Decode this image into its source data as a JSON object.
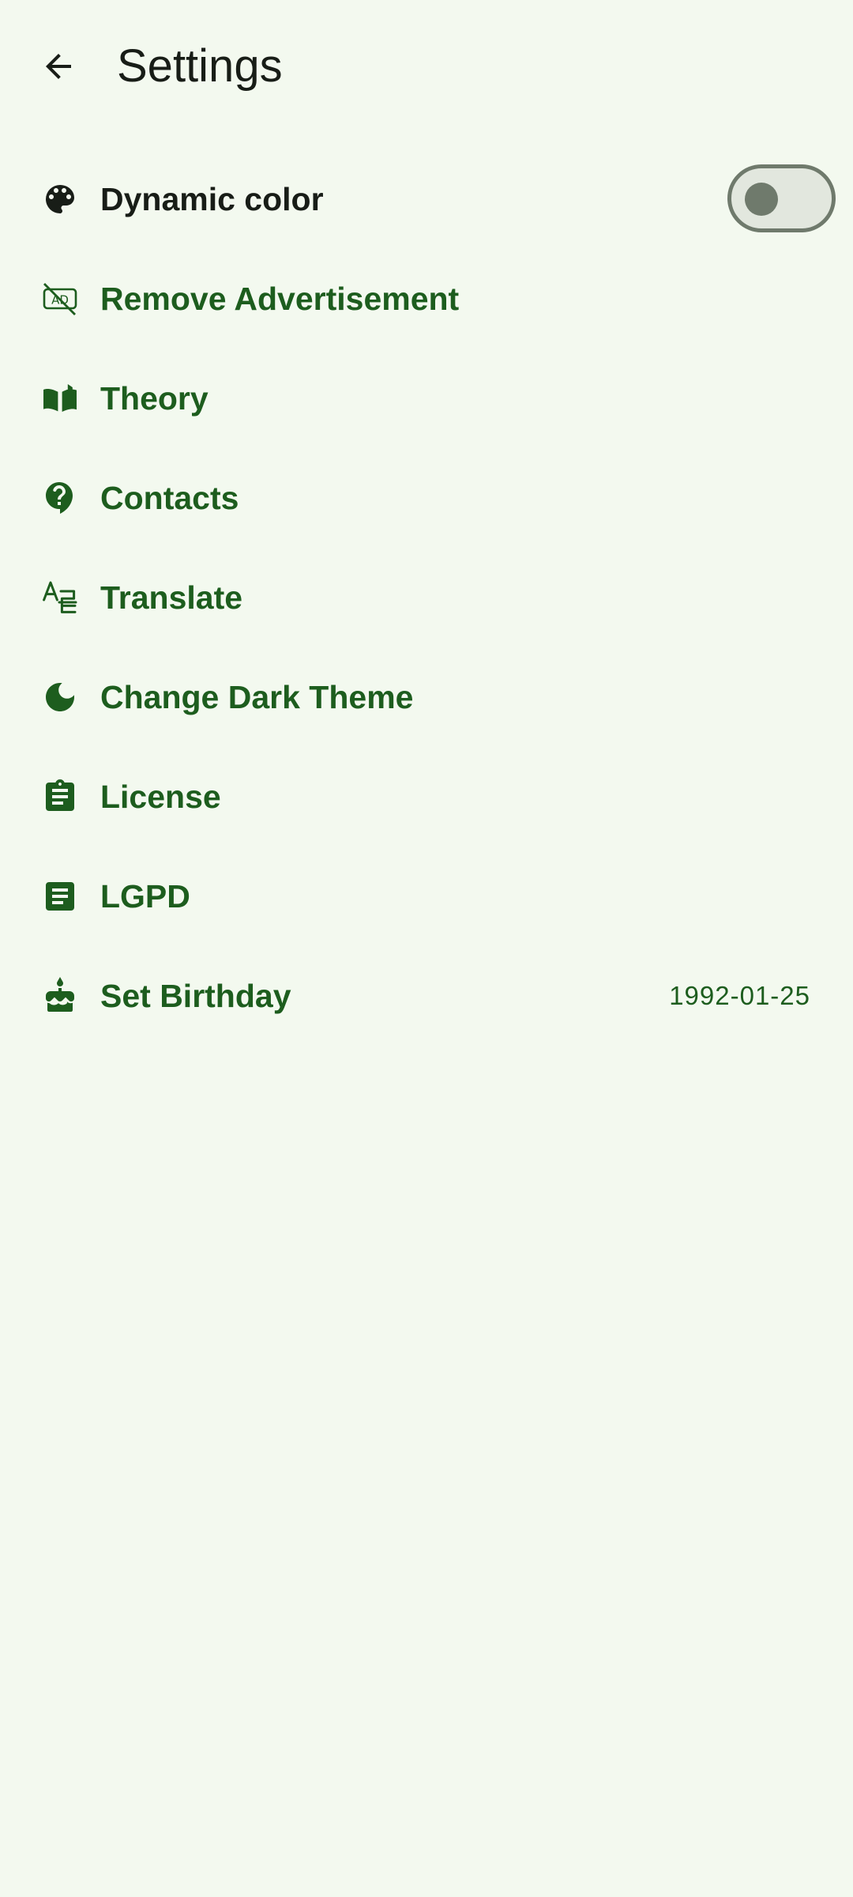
{
  "header": {
    "title": "Settings",
    "back_icon": "arrow-back-icon"
  },
  "settings": {
    "dynamic_color": {
      "label": "Dynamic color",
      "icon": "palette-icon",
      "enabled": false
    },
    "items": [
      {
        "label": "Remove Advertisement",
        "icon": "ad-off-icon"
      },
      {
        "label": "Theory",
        "icon": "book-icon"
      },
      {
        "label": "Contacts",
        "icon": "help-icon"
      },
      {
        "label": "Translate",
        "icon": "translate-icon"
      },
      {
        "label": "Change Dark Theme",
        "icon": "moon-icon"
      },
      {
        "label": "License",
        "icon": "clipboard-icon"
      },
      {
        "label": "LGPD",
        "icon": "document-icon"
      },
      {
        "label": "Set Birthday",
        "icon": "cake-icon",
        "value": "1992-01-25"
      }
    ]
  },
  "colors": {
    "background": "#f3f9ef",
    "accent": "#1d5d1e",
    "text_dark": "#181d17",
    "toggle_outline": "#6f7a6c",
    "toggle_track": "#e2e7de"
  }
}
